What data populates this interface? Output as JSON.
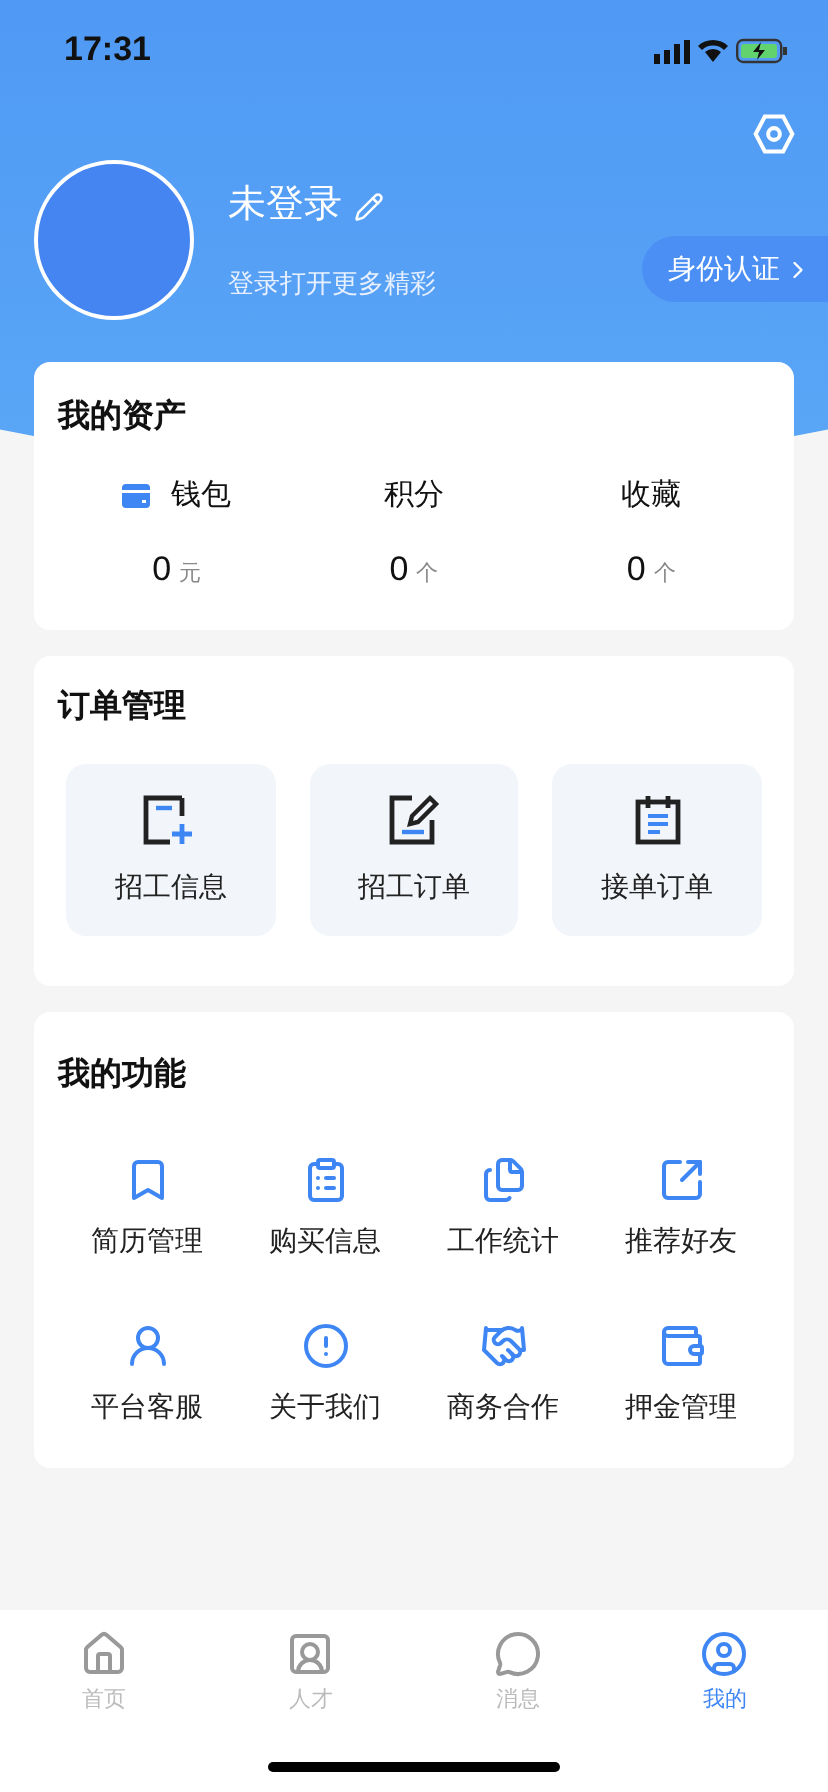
{
  "status_bar": {
    "time": "17:31"
  },
  "profile": {
    "name": "未登录",
    "subtitle": "登录打开更多精彩",
    "verify_button": "身份认证"
  },
  "assets": {
    "title": "我的资产",
    "items": [
      {
        "label": "钱包",
        "value": "0",
        "unit": "元",
        "kind": "wallet"
      },
      {
        "label": "积分",
        "value": "0",
        "unit": "个",
        "kind": "plain"
      },
      {
        "label": "收藏",
        "value": "0",
        "unit": "个",
        "kind": "plain"
      }
    ]
  },
  "orders": {
    "title": "订单管理",
    "items": [
      {
        "label": "招工信息",
        "kind": "add"
      },
      {
        "label": "招工订单",
        "kind": "edit"
      },
      {
        "label": "接单订单",
        "kind": "clipboard"
      }
    ]
  },
  "functions": {
    "title": "我的功能",
    "items": [
      {
        "label": "简历管理",
        "kind": "bookmark"
      },
      {
        "label": "购买信息",
        "kind": "list"
      },
      {
        "label": "工作统计",
        "kind": "copy"
      },
      {
        "label": "推荐好友",
        "kind": "share"
      },
      {
        "label": "平台客服",
        "kind": "service"
      },
      {
        "label": "关于我们",
        "kind": "info"
      },
      {
        "label": "商务合作",
        "kind": "handshake"
      },
      {
        "label": "押金管理",
        "kind": "deposit"
      }
    ]
  },
  "tab_bar": [
    {
      "label": "首页",
      "kind": "home",
      "selected": false
    },
    {
      "label": "人才",
      "kind": "talent",
      "selected": false
    },
    {
      "label": "消息",
      "kind": "message",
      "selected": false
    },
    {
      "label": "我的",
      "kind": "me",
      "selected": true
    }
  ]
}
